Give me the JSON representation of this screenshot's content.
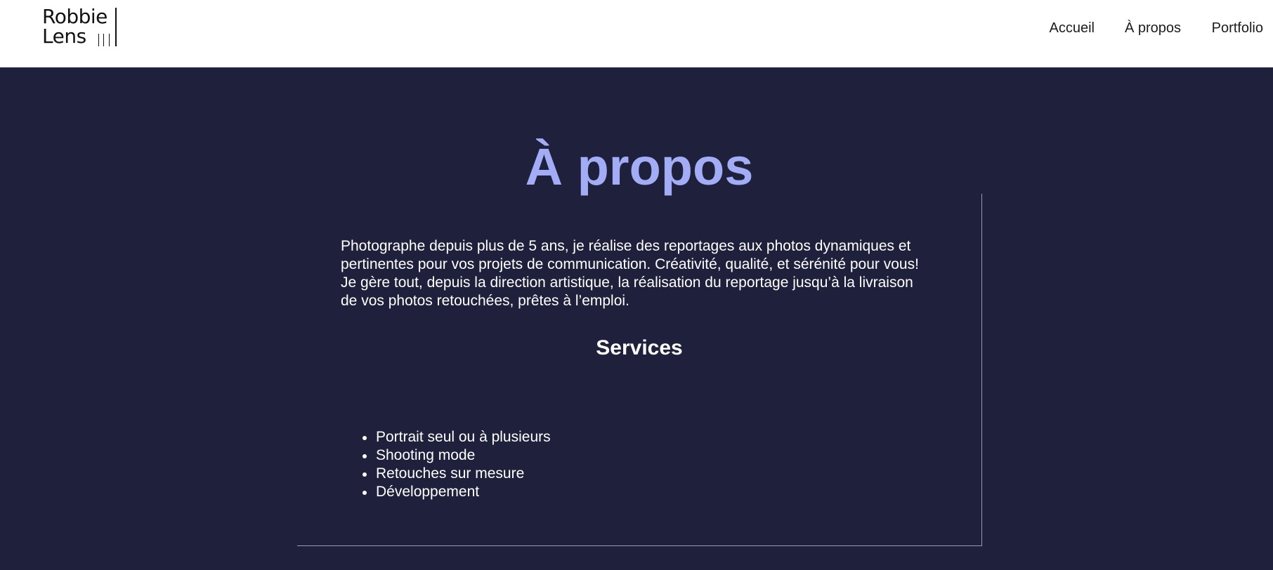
{
  "header": {
    "logo": {
      "line1": "Robbie",
      "line2": "Lens"
    },
    "nav": [
      {
        "label": "Accueil"
      },
      {
        "label": "À propos"
      },
      {
        "label": "Portfolio"
      }
    ]
  },
  "main": {
    "title": "À propos",
    "intro": "Photographe depuis plus de 5 ans, je réalise des reportages aux photos dynamiques et pertinentes pour vos projets de communication. Créativité, qualité, et sérénité pour vous! Je gère tout, depuis la direction artistique, la réalisation du reportage jusqu’à la livraison de vos photos retouchées, prêtes à l’emploi.",
    "services_title": "Services",
    "services": [
      "Portrait seul ou à plusieurs",
      "Shooting mode",
      "Retouches sur mesure",
      "Développement"
    ]
  },
  "colors": {
    "background": "#1f203b",
    "header_background": "#ffffff",
    "title_accent": "#a3adf5",
    "text": "#ffffff",
    "border": "#9a9ab4"
  }
}
